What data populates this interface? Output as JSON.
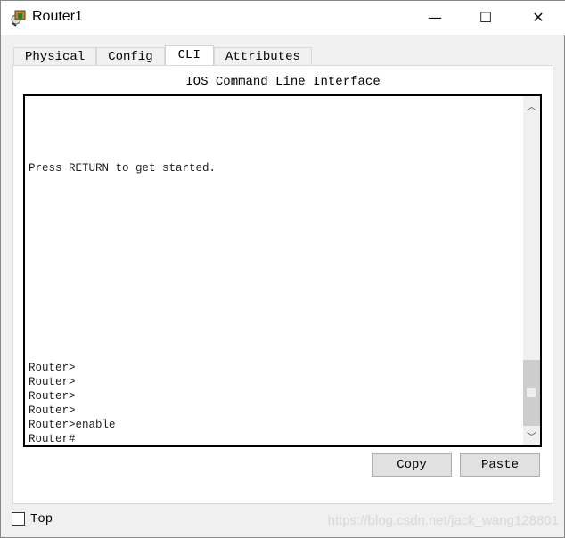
{
  "window": {
    "title": "Router1",
    "icon": "router-icon",
    "minimize": "—",
    "maximize": "☐",
    "close": "✕"
  },
  "tabs": [
    {
      "label": "Physical"
    },
    {
      "label": "Config"
    },
    {
      "label": "CLI",
      "active": true
    },
    {
      "label": "Attributes"
    }
  ],
  "cli": {
    "heading": "IOS Command Line Interface",
    "lines": [
      "Press RETURN to get started.",
      "Router>",
      "Router>",
      "Router>",
      "Router>",
      "Router>enable",
      "Router#"
    ]
  },
  "buttons": {
    "copy": "Copy",
    "paste": "Paste"
  },
  "footer": {
    "top_label": "Top",
    "top_checked": false
  },
  "watermark": "https://blog.csdn.net/jack_wang128801"
}
